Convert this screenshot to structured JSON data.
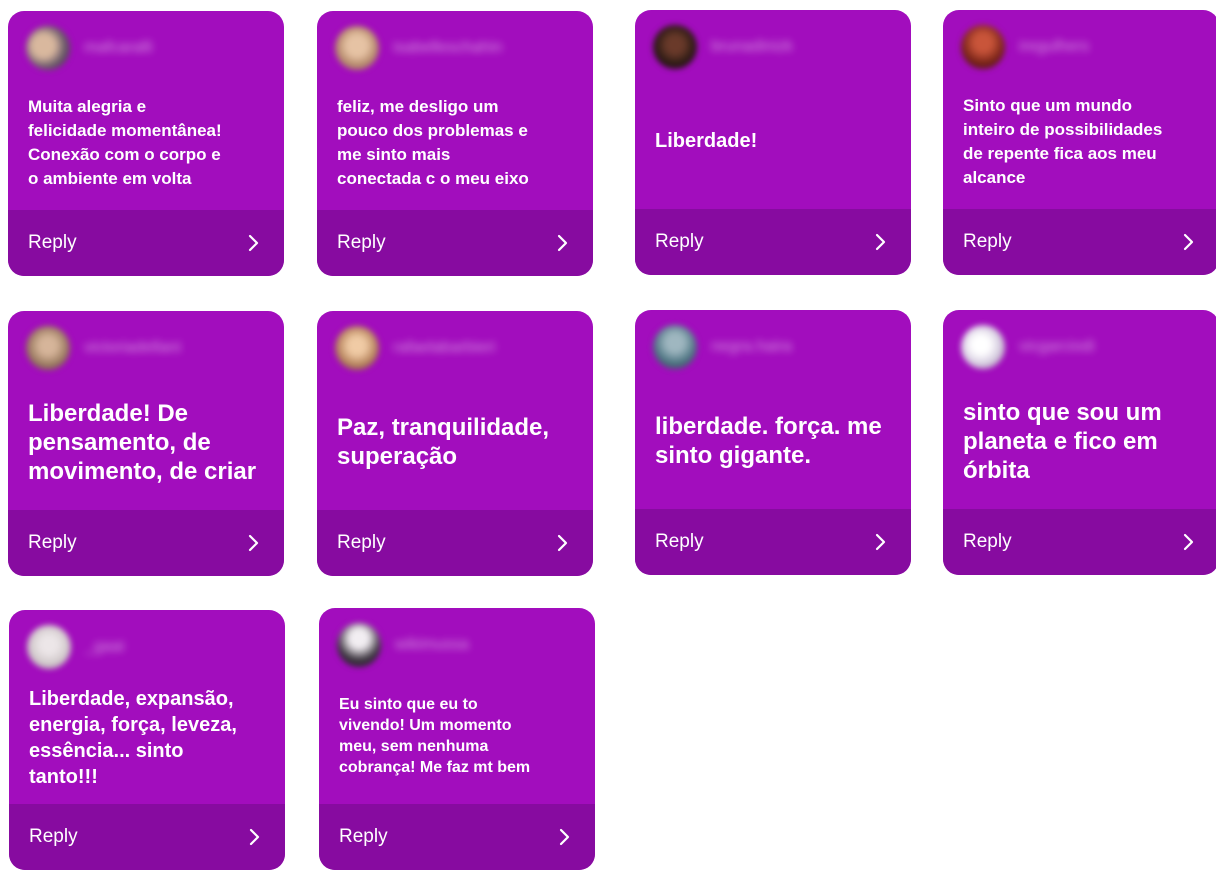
{
  "reply_label": "Reply",
  "cards": [
    {
      "username": "mafcaralli",
      "text": "Muita alegria e\nfelicidade momentânea!\nConexão com o corpo e\no ambiente em volta",
      "avatar_color": "#6b5a6a"
    },
    {
      "username": "isabelleschahin",
      "text": "feliz, me desligo um\npouco dos problemas e\nme sinto mais\nconectada c o meu eixo",
      "avatar_color": "#c79b7f"
    },
    {
      "username": "brunadinizk",
      "text": "Liberdade!",
      "avatar_color": "#2b1a14"
    },
    {
      "username": "iregulhers",
      "text": "Sinto que um mundo\ninteiro de possibilidades\nde repente fica aos meu\nalcance",
      "avatar_color": "#7a2418"
    },
    {
      "username": "victoriadellani",
      "text": "Liberdade! De\npensamento, de\nmovimento, de criar",
      "avatar_color": "#9a7a60"
    },
    {
      "username": "rafaelabarbieri",
      "text": "Paz, tranquilidade,\nsuperação",
      "avatar_color": "#b5825c"
    },
    {
      "username": "negra.haira",
      "text": "liberdade. força. me\nsinto gigante.",
      "avatar_color": "#4d7482"
    },
    {
      "username": "vicgarciodi",
      "text": "sinto que sou um\nplaneta e fico em\nórbita",
      "avatar_color": "#d8cfe2"
    },
    {
      "username": "_gaai",
      "text": "Liberdade, expansão,\nenergia, força, leveza,\nessência... sinto\ntanto!!!",
      "avatar_color": "#cfc7c9"
    },
    {
      "username": "wikimussa",
      "text": "Eu sinto que eu to\nvivendo! Um momento\nmeu, sem nenhuma\ncobrança! Me faz mt bem",
      "avatar_color": "#3d3540"
    }
  ],
  "colors": {
    "card_bg": "#a20dbd",
    "footer_bg": "#870ba0",
    "text": "#ffffff"
  }
}
